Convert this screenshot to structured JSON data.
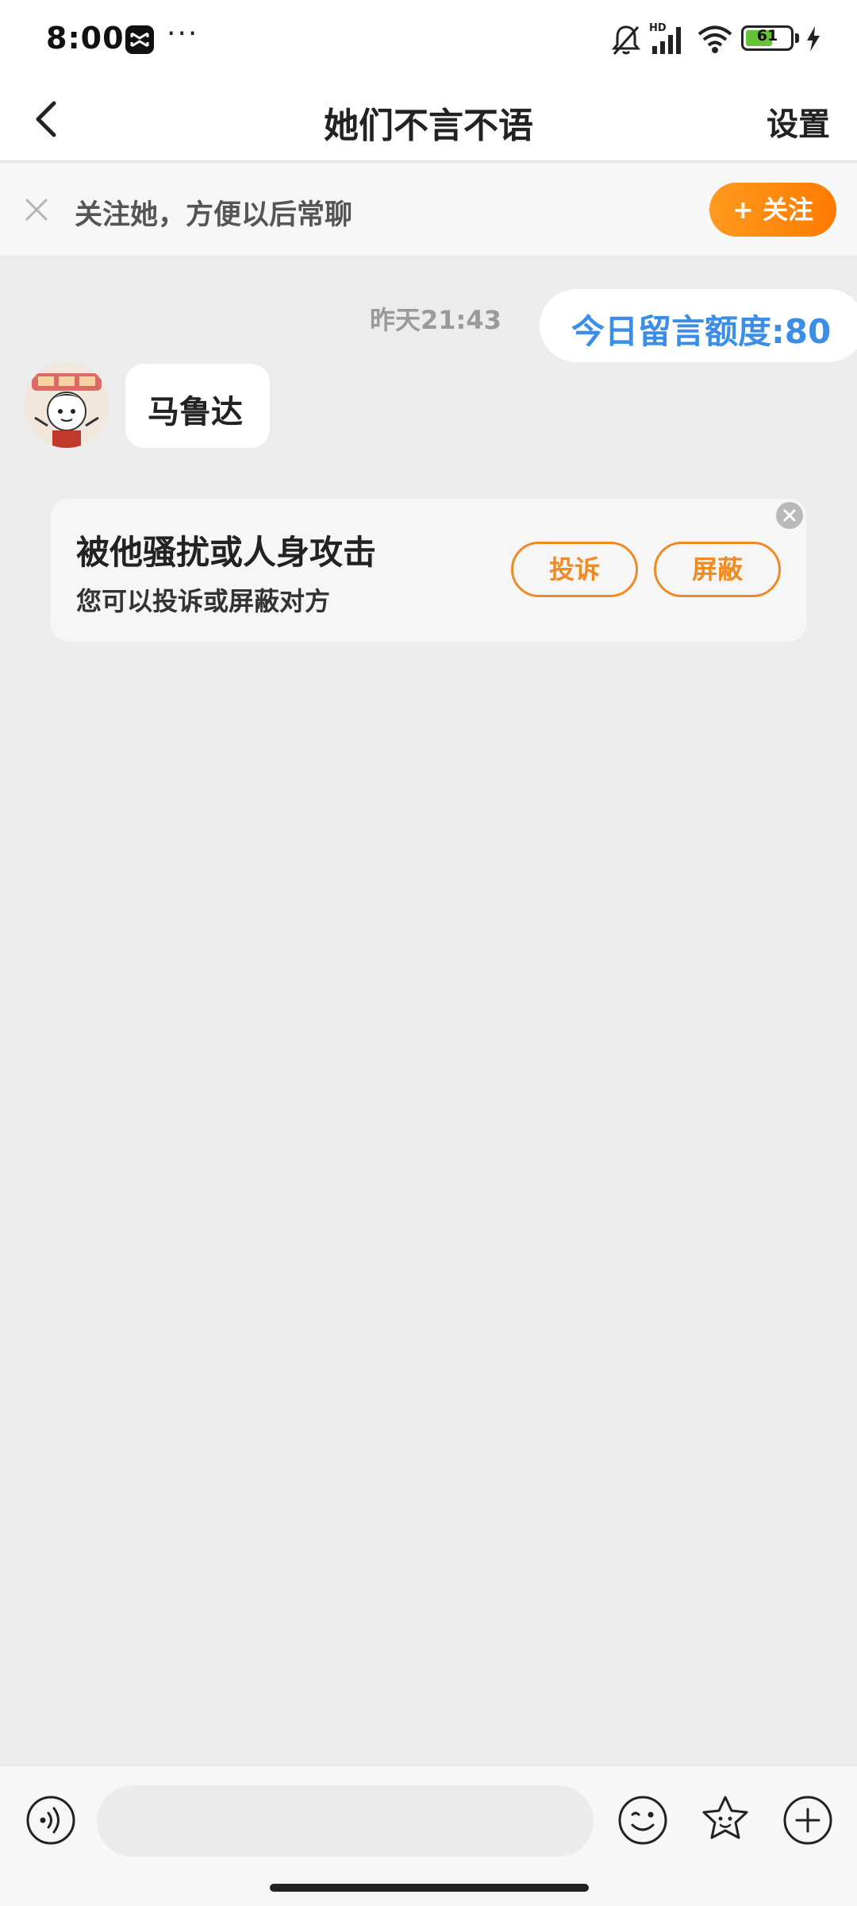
{
  "status_bar": {
    "time": "8:00",
    "network_label": "HD",
    "battery_level": "61",
    "battery_fraction": 0.61,
    "icons": [
      "capcut-icon",
      "mute-bell-icon",
      "signal-icon",
      "wifi-icon",
      "battery-icon",
      "charging-bolt-icon"
    ],
    "more": "···"
  },
  "header": {
    "back_icon": "chevron-left-icon",
    "title": "她们不言不语",
    "settings_label": "设置"
  },
  "follow_banner": {
    "close_icon": "close-icon",
    "text": "关注她，方便以后常聊",
    "follow_button_label": "+ 关注"
  },
  "chat": {
    "timestamp": "昨天21:43",
    "quota_text": "今日留言额度:80",
    "messages": [
      {
        "sender": "other",
        "avatar_icon": "avatar",
        "text": "马鲁达"
      }
    ]
  },
  "report_card": {
    "title": "被他骚扰或人身攻击",
    "subtitle": "您可以投诉或屏蔽对方",
    "complain_label": "投诉",
    "block_label": "屏蔽",
    "close_icon": "close-circle-icon"
  },
  "input_bar": {
    "message_value": "",
    "icons": [
      "voice-icon",
      "emoji-icon",
      "sticker-icon",
      "plus-icon"
    ]
  },
  "colors": {
    "accent_orange": "#ff8a00",
    "quota_blue": "#3a8ee6",
    "chat_background": "#ececec",
    "battery_green": "#67c23a"
  }
}
